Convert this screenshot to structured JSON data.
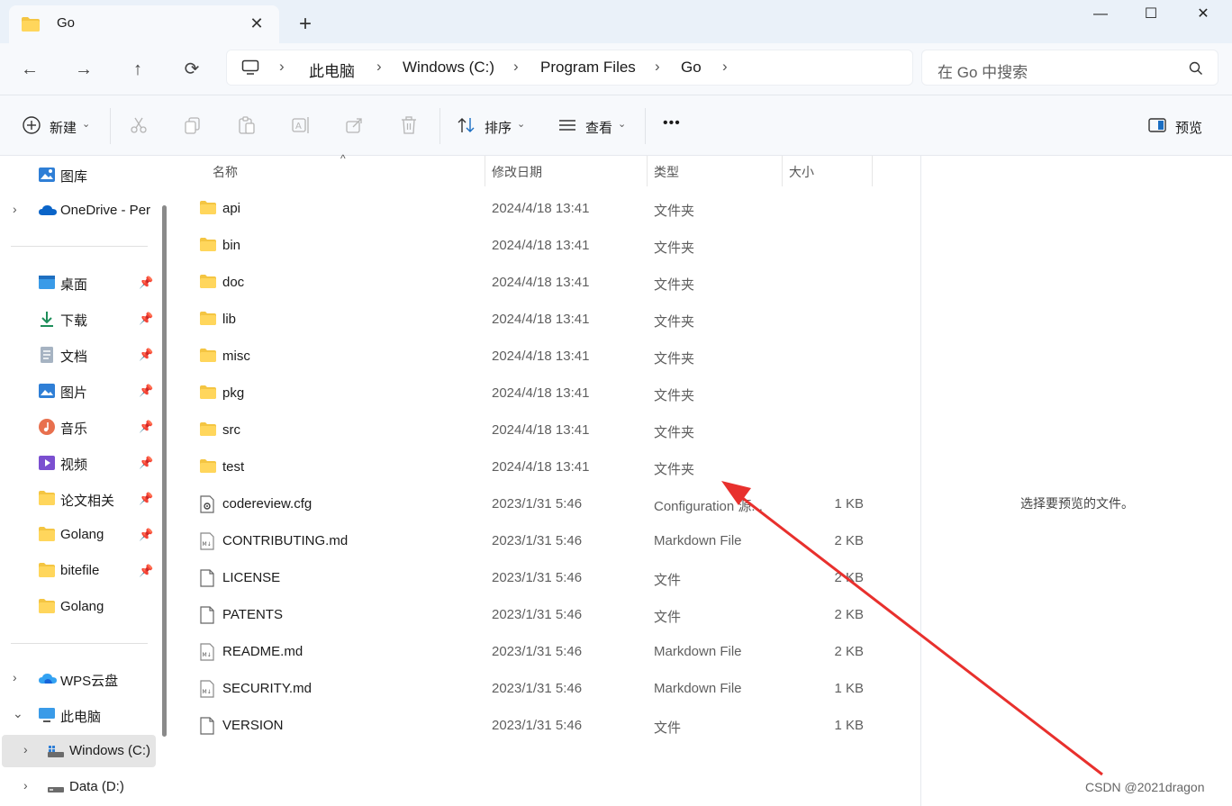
{
  "window": {
    "tab_title": "Go",
    "close_tab": "✕",
    "new_tab": "+",
    "minimize": "—",
    "maximize": "☐",
    "close": "✕"
  },
  "address": {
    "crumbs": [
      "此电脑",
      "Windows (C:)",
      "Program Files",
      "Go"
    ],
    "search_placeholder": "在 Go 中搜索"
  },
  "toolbar": {
    "new_label": "新建",
    "sort_label": "排序",
    "view_label": "查看",
    "more_label": "•••",
    "preview_label": "预览"
  },
  "sidebar": {
    "items": [
      {
        "label": "图库",
        "icon": "gallery-icon"
      },
      {
        "label": "OneDrive - Per",
        "icon": "onedrive-icon"
      },
      {
        "label": "桌面",
        "icon": "desktop-icon"
      },
      {
        "label": "下载",
        "icon": "download-icon"
      },
      {
        "label": "文档",
        "icon": "document-icon"
      },
      {
        "label": "图片",
        "icon": "pictures-icon"
      },
      {
        "label": "音乐",
        "icon": "music-icon"
      },
      {
        "label": "视频",
        "icon": "video-icon"
      },
      {
        "label": "论文相关",
        "icon": "folder-icon"
      },
      {
        "label": "Golang",
        "icon": "folder-icon"
      },
      {
        "label": "bitefile",
        "icon": "folder-icon"
      },
      {
        "label": "Golang",
        "icon": "folder-icon"
      },
      {
        "label": "WPS云盘",
        "icon": "wps-cloud-icon"
      },
      {
        "label": "此电脑",
        "icon": "pc-icon"
      },
      {
        "label": "Windows (C:)",
        "icon": "drive-icon"
      },
      {
        "label": "Data (D:)",
        "icon": "drive-icon"
      }
    ]
  },
  "columns": {
    "name": "名称",
    "modified": "修改日期",
    "type": "类型",
    "size": "大小"
  },
  "files": [
    {
      "name": "api",
      "date": "2024/4/18 13:41",
      "type": "文件夹",
      "size": "",
      "icon": "folder-icon"
    },
    {
      "name": "bin",
      "date": "2024/4/18 13:41",
      "type": "文件夹",
      "size": "",
      "icon": "folder-icon"
    },
    {
      "name": "doc",
      "date": "2024/4/18 13:41",
      "type": "文件夹",
      "size": "",
      "icon": "folder-icon"
    },
    {
      "name": "lib",
      "date": "2024/4/18 13:41",
      "type": "文件夹",
      "size": "",
      "icon": "folder-icon"
    },
    {
      "name": "misc",
      "date": "2024/4/18 13:41",
      "type": "文件夹",
      "size": "",
      "icon": "folder-icon"
    },
    {
      "name": "pkg",
      "date": "2024/4/18 13:41",
      "type": "文件夹",
      "size": "",
      "icon": "folder-icon"
    },
    {
      "name": "src",
      "date": "2024/4/18 13:41",
      "type": "文件夹",
      "size": "",
      "icon": "folder-icon"
    },
    {
      "name": "test",
      "date": "2024/4/18 13:41",
      "type": "文件夹",
      "size": "",
      "icon": "folder-icon"
    },
    {
      "name": "codereview.cfg",
      "date": "2023/1/31 5:46",
      "type": "Configuration 源...",
      "size": "1 KB",
      "icon": "config-file-icon"
    },
    {
      "name": "CONTRIBUTING.md",
      "date": "2023/1/31 5:46",
      "type": "Markdown File",
      "size": "2 KB",
      "icon": "markdown-file-icon"
    },
    {
      "name": "LICENSE",
      "date": "2023/1/31 5:46",
      "type": "文件",
      "size": "2 KB",
      "icon": "file-icon"
    },
    {
      "name": "PATENTS",
      "date": "2023/1/31 5:46",
      "type": "文件",
      "size": "2 KB",
      "icon": "file-icon"
    },
    {
      "name": "README.md",
      "date": "2023/1/31 5:46",
      "type": "Markdown File",
      "size": "2 KB",
      "icon": "markdown-file-icon"
    },
    {
      "name": "SECURITY.md",
      "date": "2023/1/31 5:46",
      "type": "Markdown File",
      "size": "1 KB",
      "icon": "markdown-file-icon"
    },
    {
      "name": "VERSION",
      "date": "2023/1/31 5:46",
      "type": "文件",
      "size": "1 KB",
      "icon": "file-icon"
    }
  ],
  "preview": {
    "message": "选择要预览的文件。"
  },
  "watermark": "CSDN @2021dragon",
  "colors": {
    "folder": "#f4c542",
    "accent": "#0067c0",
    "annotation_arrow": "#e8302d"
  }
}
